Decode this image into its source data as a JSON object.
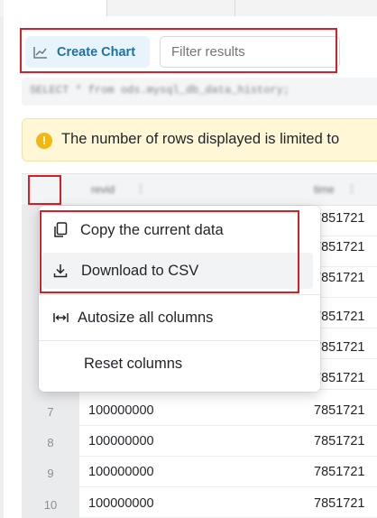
{
  "toolbar": {
    "create_chart_label": "Create Chart",
    "filter_placeholder": "Filter results"
  },
  "query": {
    "text": "SELECT * from ods.mysql_db_data_history;"
  },
  "warning": {
    "text": "The number of rows displayed is limited to"
  },
  "grid": {
    "columns": [
      "revid",
      "time"
    ],
    "rows": [
      {
        "num": "7",
        "c1": "100000000",
        "c2": "7851721"
      },
      {
        "num": "8",
        "c1": "100000000",
        "c2": "7851721"
      },
      {
        "num": "9",
        "c1": "100000000",
        "c2": "7851721"
      },
      {
        "num": "10",
        "c1": "100000000",
        "c2": "7851721"
      }
    ],
    "hidden_c2": "7851721"
  },
  "menu": {
    "copy": "Copy the current data",
    "download": "Download to CSV",
    "autosize": "Autosize all columns",
    "reset": "Reset columns"
  },
  "colors": {
    "accent": "#1a73a8",
    "highlight_box": "#d61f26",
    "warning_bg": "#fff7d6",
    "warning_icon": "#f2b713"
  }
}
